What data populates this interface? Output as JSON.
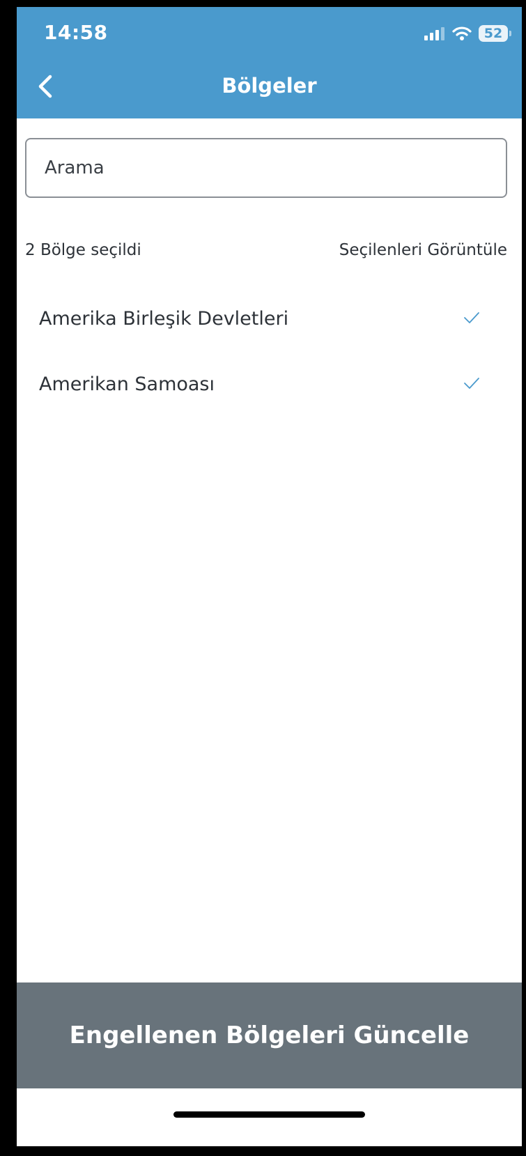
{
  "status_bar": {
    "time": "14:58",
    "battery": "52",
    "icons": [
      "signal-icon",
      "wifi-icon",
      "battery-icon"
    ]
  },
  "header": {
    "title": "Bölgeler",
    "back_icon": "chevron-left-icon"
  },
  "search": {
    "placeholder": "Arama",
    "value": ""
  },
  "selection": {
    "count_label": "2 Bölge seçildi",
    "view_selected_label": "Seçilenleri Görüntüle"
  },
  "regions": [
    {
      "label": "Amerika Birleşik Devletleri",
      "selected": true
    },
    {
      "label": "Amerikan Samoası",
      "selected": true
    }
  ],
  "footer": {
    "update_button_label": "Engellenen Bölgeleri Güncelle"
  },
  "colors": {
    "header_bg": "#4a9acd",
    "accent": "#4a9acd",
    "footer_button_bg": "#68737b",
    "text": "#2d3238"
  }
}
